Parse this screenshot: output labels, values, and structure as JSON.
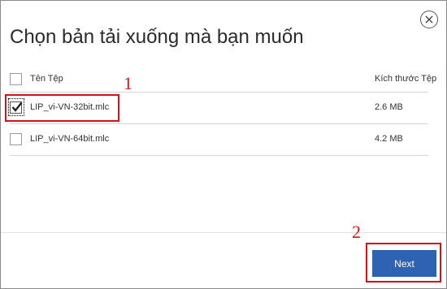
{
  "dialog": {
    "title": "Chọn bản tải xuống mà bạn muốn",
    "close_icon": "close-circle-icon"
  },
  "table": {
    "columns": [
      "Tên Tệp",
      "Kích thước Tệp"
    ],
    "rows": [
      {
        "name": "LIP_vi-VN-32bit.mlc",
        "size": "2.6 MB",
        "checked": true
      },
      {
        "name": "LIP_vi-VN-64bit.mlc",
        "size": "4.2 MB",
        "checked": false
      }
    ]
  },
  "annotations": {
    "step1": "1",
    "step2": "2",
    "color": "#d0121b"
  },
  "footer": {
    "next_label": "Next",
    "next_color": "#2e62b3"
  }
}
